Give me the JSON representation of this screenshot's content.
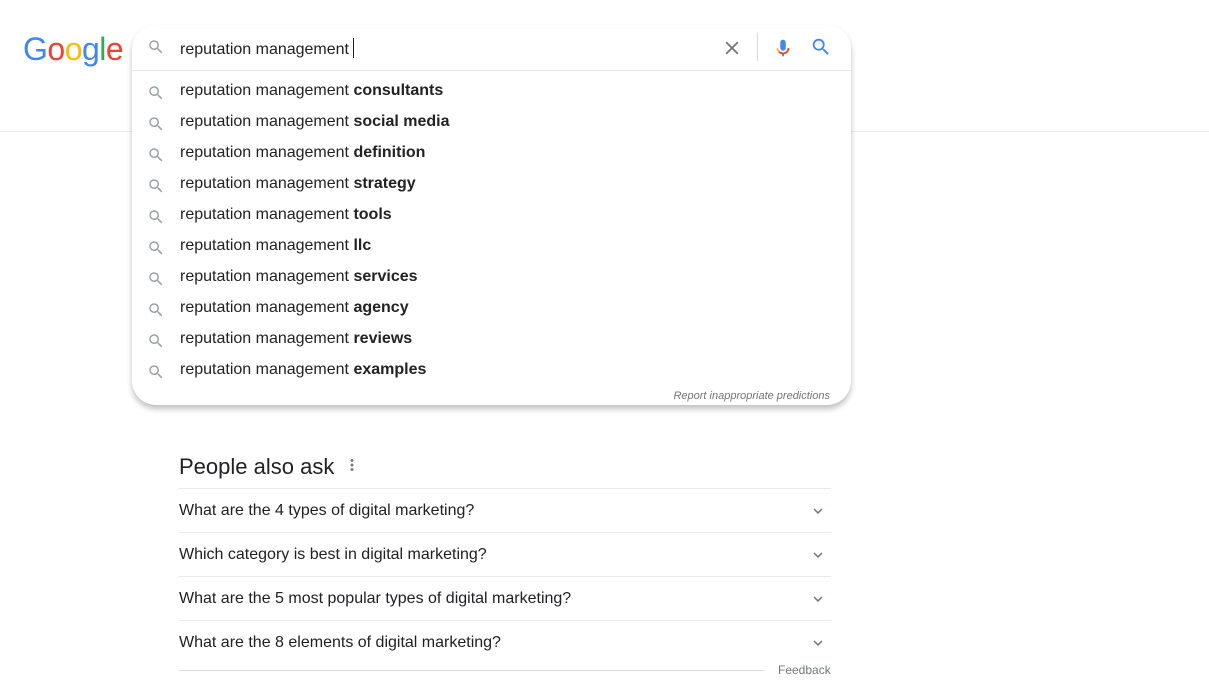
{
  "logo": {
    "letters": [
      {
        "char": "G",
        "color": "#4285F4"
      },
      {
        "char": "o",
        "color": "#EA4335"
      },
      {
        "char": "o",
        "color": "#FBBC05"
      },
      {
        "char": "g",
        "color": "#4285F4"
      },
      {
        "char": "l",
        "color": "#34A853"
      },
      {
        "char": "e",
        "color": "#EA4335"
      }
    ]
  },
  "search": {
    "value": "reputation management",
    "icons": {
      "lead": "search-icon",
      "clear": "close-icon",
      "voice": "mic-icon",
      "submit": "search-icon"
    }
  },
  "suggestions": [
    {
      "prefix": "reputation management ",
      "completion": "consultants"
    },
    {
      "prefix": "reputation management ",
      "completion": "social media"
    },
    {
      "prefix": "reputation management ",
      "completion": "definition"
    },
    {
      "prefix": "reputation management ",
      "completion": "strategy"
    },
    {
      "prefix": "reputation management ",
      "completion": "tools"
    },
    {
      "prefix": "reputation management ",
      "completion": "llc"
    },
    {
      "prefix": "reputation management ",
      "completion": "services"
    },
    {
      "prefix": "reputation management ",
      "completion": "agency"
    },
    {
      "prefix": "reputation management ",
      "completion": "reviews"
    },
    {
      "prefix": "reputation management ",
      "completion": "examples"
    }
  ],
  "report_link": "Report inappropriate predictions",
  "people_also_ask": {
    "title": "People also ask",
    "questions": [
      "What are the 4 types of digital marketing?",
      "Which category is best in digital marketing?",
      "What are the 5 most popular types of digital marketing?",
      "What are the 8 elements of digital marketing?"
    ]
  },
  "feedback_label": "Feedback",
  "colors": {
    "google_blue": "#4285F4",
    "google_red": "#EA4335",
    "google_yellow": "#FBBC05",
    "google_green": "#34A853",
    "icon_gray": "#9aa0a6"
  }
}
